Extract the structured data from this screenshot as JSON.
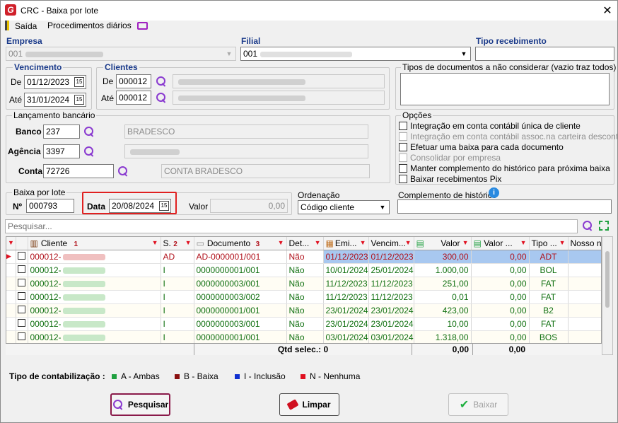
{
  "window": {
    "title": "CRC - Baixa por lote",
    "close": "✕"
  },
  "menu": {
    "exit": "Saída",
    "daily": "Procedimentos diários"
  },
  "empresa": {
    "label": "Empresa",
    "value": "001"
  },
  "filial": {
    "label": "Filial",
    "value": "001"
  },
  "tipo_recebimento": {
    "label": "Tipo recebimento",
    "value": ""
  },
  "vencimento": {
    "label": "Vencimento",
    "de_label": "De",
    "de": "01/12/2023",
    "ate_label": "Até",
    "ate": "31/01/2024"
  },
  "clientes": {
    "label": "Clientes",
    "de_label": "De",
    "de": "000012",
    "ate_label": "Até",
    "ate": "000012"
  },
  "tipos_doc": {
    "label": "Tipos de documentos a não considerar (vazio traz todos)",
    "value": ""
  },
  "lancamento": {
    "label": "Lançamento bancário",
    "banco_label": "Banco",
    "banco": "237",
    "banco_nome": "BRADESCO",
    "agencia_label": "Agência",
    "agencia": "3397",
    "conta_label": "Conta",
    "conta": "72726",
    "conta_nome": "CONTA BRADESCO"
  },
  "opcoes": {
    "label": "Opções",
    "items": [
      {
        "label": "Integração em conta contábil única de cliente",
        "enabled": true
      },
      {
        "label": "Integração em conta contábil assoc.na carteira descontada",
        "enabled": false
      },
      {
        "label": "Efetuar uma baixa para cada documento",
        "enabled": true
      },
      {
        "label": "Consolidar por empresa",
        "enabled": false
      },
      {
        "label": "Manter complemento do histórico para próxima baixa",
        "enabled": true
      },
      {
        "label": "Baixar recebimentos Pix",
        "enabled": true
      }
    ]
  },
  "baixa_lote": {
    "label": "Baixa por lote",
    "num_label": "Nº",
    "num": "000793",
    "data_label": "Data",
    "data": "20/08/2024",
    "valor_label": "Valor",
    "valor": "0,00"
  },
  "ordenacao": {
    "label": "Ordenação",
    "value": "Código cliente"
  },
  "complemento": {
    "label": "Complemento de histórico",
    "value": "",
    "info": "i"
  },
  "pesquisar": {
    "placeholder": "Pesquisar..."
  },
  "table": {
    "headers": [
      "Cliente",
      "S.",
      "Documento",
      "Det...",
      "Emi...",
      "Vencim...",
      "Valor",
      "Valor ...",
      "Tipo ...",
      "Nosso nú"
    ],
    "sort_nums": [
      "1",
      "2",
      "3"
    ],
    "rows": [
      {
        "cliente": "000012-",
        "s": "AD",
        "doc": "AD-0000001/001",
        "det": "Não",
        "emi": "01/12/2023",
        "venc": "01/12/2023",
        "valor": "300,00",
        "valor2": "0,00",
        "tipo": "ADT",
        "color": "red"
      },
      {
        "cliente": "000012-",
        "s": "I",
        "doc": "0000000001/001",
        "det": "Não",
        "emi": "10/01/2024",
        "venc": "25/01/2024",
        "valor": "1.000,00",
        "valor2": "0,00",
        "tipo": "BOL",
        "color": "grn"
      },
      {
        "cliente": "000012-",
        "s": "I",
        "doc": "0000000003/001",
        "det": "Não",
        "emi": "11/12/2023",
        "venc": "11/12/2023",
        "valor": "251,00",
        "valor2": "0,00",
        "tipo": "FAT",
        "color": "grn"
      },
      {
        "cliente": "000012-",
        "s": "I",
        "doc": "0000000003/002",
        "det": "Não",
        "emi": "11/12/2023",
        "venc": "11/12/2023",
        "valor": "0,01",
        "valor2": "0,00",
        "tipo": "FAT",
        "color": "grn"
      },
      {
        "cliente": "000012-",
        "s": "I",
        "doc": "0000000001/001",
        "det": "Não",
        "emi": "23/01/2024",
        "venc": "23/01/2024",
        "valor": "423,00",
        "valor2": "0,00",
        "tipo": "B2",
        "color": "grn"
      },
      {
        "cliente": "000012-",
        "s": "I",
        "doc": "0000000003/001",
        "det": "Não",
        "emi": "23/01/2024",
        "venc": "23/01/2024",
        "valor": "10,00",
        "valor2": "0,00",
        "tipo": "FAT",
        "color": "grn"
      },
      {
        "cliente": "000012-",
        "s": "I",
        "doc": "0000000001/001",
        "det": "Não",
        "emi": "03/01/2024",
        "venc": "03/01/2024",
        "valor": "1.318,00",
        "valor2": "0,00",
        "tipo": "BOS",
        "color": "grn"
      }
    ],
    "footer": {
      "qtd": "Qtd selec.: 0",
      "total": "0,00",
      "total2": "0,00"
    }
  },
  "legend": {
    "label": "Tipo de contabilização :",
    "items": [
      {
        "label": "A - Ambas",
        "color": "#20a040"
      },
      {
        "label": "B - Baixa",
        "color": "#8a1010"
      },
      {
        "label": "I - Inclusão",
        "color": "#1030d0"
      },
      {
        "label": "N - Nenhuma",
        "color": "#e01020"
      }
    ]
  },
  "buttons": {
    "pesquisar": "Pesquisar",
    "limpar": "Limpar",
    "baixar": "Baixar"
  }
}
